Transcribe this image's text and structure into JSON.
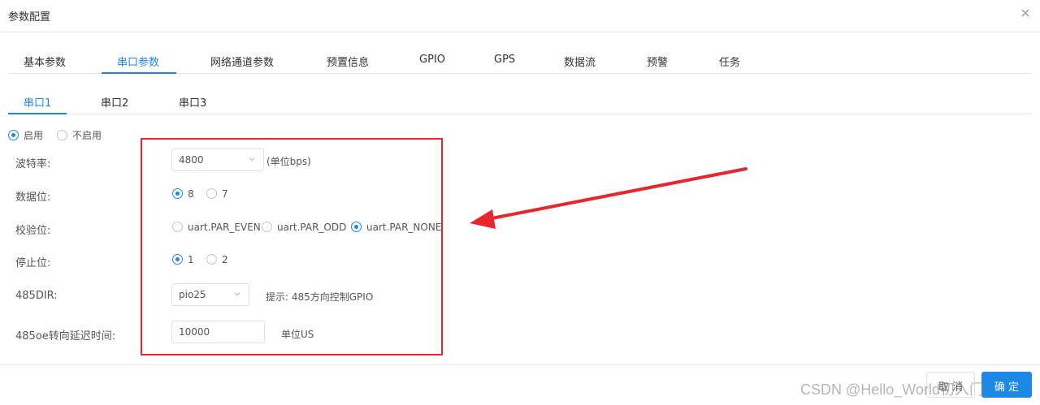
{
  "dialog": {
    "title": "参数配置"
  },
  "main_tabs": [
    {
      "label": "基本参数",
      "active": false
    },
    {
      "label": "串口参数",
      "active": true
    },
    {
      "label": "网络通道参数",
      "active": false
    },
    {
      "label": "预置信息",
      "active": false
    },
    {
      "label": "GPIO",
      "active": false
    },
    {
      "label": "GPS",
      "active": false
    },
    {
      "label": "数据流",
      "active": false
    },
    {
      "label": "预警",
      "active": false
    },
    {
      "label": "任务",
      "active": false
    }
  ],
  "sub_tabs": [
    {
      "label": "串口1",
      "active": true
    },
    {
      "label": "串口2",
      "active": false
    },
    {
      "label": "串口3",
      "active": false
    }
  ],
  "enable": {
    "options": [
      {
        "label": "启用",
        "checked": true
      },
      {
        "label": "不启用",
        "checked": false
      }
    ]
  },
  "form": {
    "baud": {
      "label": "波特率:",
      "value": "4800",
      "unit": "(单位bps)"
    },
    "data_bits": {
      "label": "数据位:",
      "options": [
        {
          "label": "8",
          "checked": true
        },
        {
          "label": "7",
          "checked": false
        }
      ]
    },
    "parity": {
      "label": "校验位:",
      "options": [
        {
          "label": "uart.PAR_EVEN",
          "checked": false
        },
        {
          "label": "uart.PAR_ODD",
          "checked": false
        },
        {
          "label": "uart.PAR_NONE",
          "checked": true
        }
      ]
    },
    "stop_bits": {
      "label": "停止位:",
      "options": [
        {
          "label": "1",
          "checked": true
        },
        {
          "label": "2",
          "checked": false
        }
      ]
    },
    "dir485": {
      "label": "485DIR:",
      "value": "pio25",
      "hint": "提示: 485方向控制GPIO"
    },
    "delay": {
      "label": "485oe转向延迟时间:",
      "value": "10000",
      "unit": "单位US"
    }
  },
  "footer": {
    "cancel_label": "取 消",
    "ok_label": "确 定"
  },
  "watermark": "CSDN @Hello_World初入门",
  "colors": {
    "accent": "#1e88e5",
    "annotation": "#e8262d"
  }
}
